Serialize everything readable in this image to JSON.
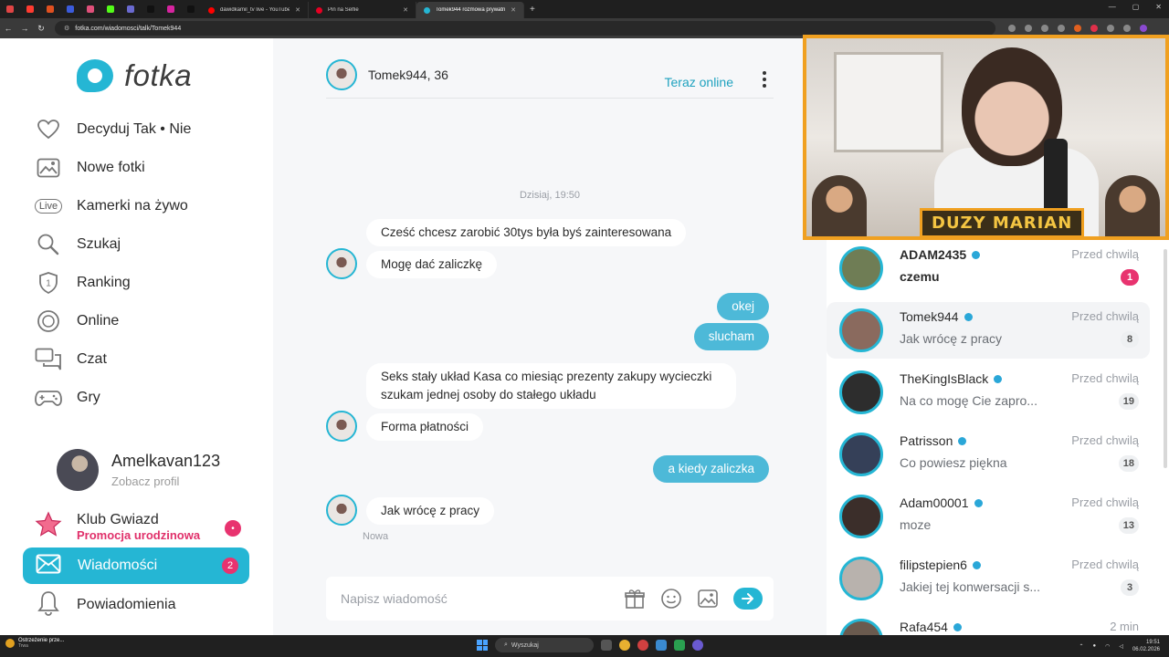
{
  "browser": {
    "tabs": [
      {
        "label": "dawidkamil_tv live - YouTube",
        "color": "#ff0000"
      },
      {
        "label": "Pin na Selfie",
        "color": "#e60023"
      },
      {
        "label": "Tomek944 rozmowa prywatna",
        "color": "#25b6d4",
        "active": true
      }
    ],
    "url": "fotka.com/wiadomosci/talk/Tomek944",
    "new_tab_icon": "plus-icon"
  },
  "sidebar": {
    "logo": "fotka",
    "menu": [
      {
        "label": "Decyduj Tak • Nie",
        "icon": "heart-icon"
      },
      {
        "label": "Nowe fotki",
        "icon": "image-icon"
      },
      {
        "label": "Kamerki na żywo",
        "icon": "live-icon",
        "badge": "Live"
      },
      {
        "label": "Szukaj",
        "icon": "search-icon"
      },
      {
        "label": "Ranking",
        "icon": "shield-icon",
        "badge": "1"
      },
      {
        "label": "Online",
        "icon": "circle-icon"
      },
      {
        "label": "Czat",
        "icon": "chat-icon"
      },
      {
        "label": "Gry",
        "icon": "gamepad-icon"
      }
    ],
    "profile": {
      "name": "Amelkavan123",
      "sub": "Zobacz profil"
    },
    "club": {
      "title": "Klub Gwiazd",
      "sub": "Promocja urodzinowa",
      "badge": "•"
    },
    "messages": {
      "label": "Wiadomości",
      "count": "2"
    },
    "notifications": {
      "label": "Powiadomienia"
    }
  },
  "chat": {
    "partner": "Tomek944, 36",
    "status": "Teraz online",
    "date": "Dzisiaj, 19:50",
    "messages": [
      {
        "dir": "in",
        "text": "Cześć chcesz zarobić 30tys była byś zainteresowana"
      },
      {
        "dir": "in",
        "text": "Mogę dać zaliczkę"
      },
      {
        "dir": "out",
        "text": "okej"
      },
      {
        "dir": "out",
        "text": "slucham"
      },
      {
        "dir": "in",
        "text": "Seks stały układ Kasa co miesiąc prezenty zakupy wycieczki szukam jednej osoby do stałego układu"
      },
      {
        "dir": "in",
        "text": "Forma płatności"
      },
      {
        "dir": "out",
        "text": "a kiedy zaliczka"
      },
      {
        "dir": "in",
        "text": "Jak wrócę z pracy"
      }
    ],
    "new_label": "Nowa",
    "composer_placeholder": "Napisz wiadomość"
  },
  "overlay": {
    "caption": "DUZY MARIAN"
  },
  "conversations": [
    {
      "name": "ADAM2435",
      "preview": "czemu",
      "time": "Przed chwilą",
      "count": "1",
      "unread": true,
      "avatar_color": "#6f7d55"
    },
    {
      "name": "Tomek944",
      "preview": "Jak wrócę z pracy",
      "time": "Przed chwilą",
      "count": "8",
      "selected": true,
      "avatar_color": "#8a6a5e"
    },
    {
      "name": "TheKingIsBlack",
      "preview": "Na co mogę Cie zapro...",
      "time": "Przed chwilą",
      "count": "19",
      "avatar_color": "#2d2d2d"
    },
    {
      "name": "Patrisson",
      "preview": "Co powiesz piękna",
      "time": "Przed chwilą",
      "count": "18",
      "avatar_color": "#354058"
    },
    {
      "name": "Adam00001",
      "preview": "moze",
      "time": "Przed chwilą",
      "count": "13",
      "avatar_color": "#3b2e2a"
    },
    {
      "name": "filipstepien6",
      "preview": "Jakiej tej konwersacji s...",
      "time": "Przed chwilą",
      "count": "3",
      "avatar_color": "#b8b2ad"
    },
    {
      "name": "Rafa454",
      "preview": "",
      "time": "2 min",
      "count": "",
      "avatar_color": "#6a5a4e"
    }
  ],
  "taskbar": {
    "warning_title": "Ostrzeżenie prze...",
    "warning_sub": "Trwa",
    "search": "Wyszukaj",
    "time": "19:51",
    "date": "06.02.2026"
  }
}
